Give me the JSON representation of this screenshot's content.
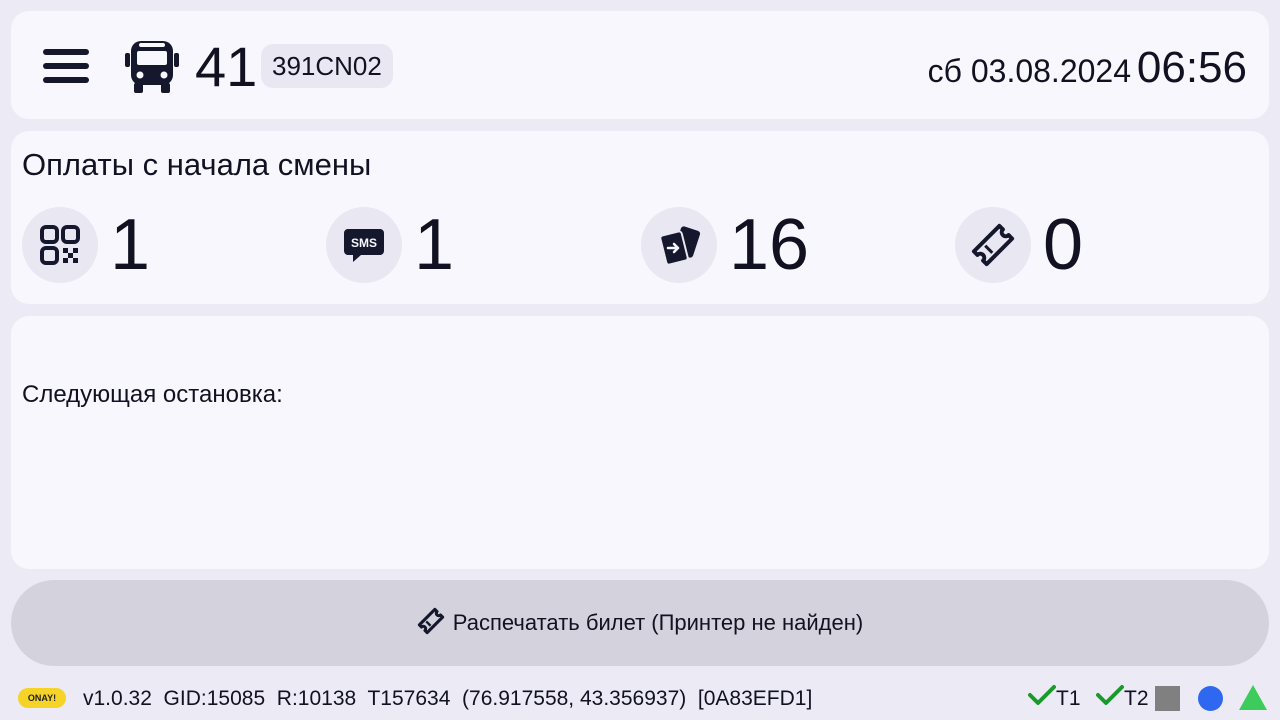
{
  "header": {
    "route_number": "41",
    "vehicle_plate": "391CN02",
    "date": "сб 03.08.2024",
    "time": "06:56"
  },
  "payments": {
    "title": "Оплаты с начала смены",
    "items": [
      {
        "icon": "qr-code-icon",
        "value": "1"
      },
      {
        "icon": "sms-icon",
        "value": "1"
      },
      {
        "icon": "card-tap-icon",
        "value": "16"
      },
      {
        "icon": "ticket-icon",
        "value": "0"
      }
    ]
  },
  "next_stop": {
    "label": "Следующая остановка:"
  },
  "print_button": {
    "label": "Распечатать билет (Принтер не найден)"
  },
  "status_bar": {
    "logo": "ONAY!",
    "info": "v1.0.32  GID:15085  R:10138  T157634  (76.917558, 43.356937)  [0A83EFD1]",
    "t1": "T1",
    "t2": "T2"
  },
  "colors": {
    "indicator_square": "#808080",
    "indicator_circle": "#2e67f0",
    "indicator_triangle": "#3dcc5c",
    "check": "#1a9a2c"
  }
}
